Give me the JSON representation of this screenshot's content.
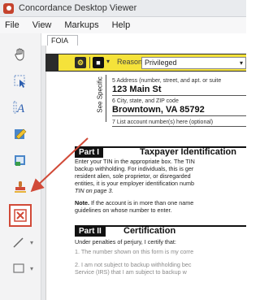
{
  "window": {
    "title": "Concordance Desktop Viewer"
  },
  "menu": [
    "File",
    "View",
    "Markups",
    "Help"
  ],
  "document_tab": "FOIA",
  "redaction_toolbar": {
    "reason_label": "Reason",
    "reason_value": "Privileged"
  },
  "tools": [
    {
      "name": "hand-icon"
    },
    {
      "name": "select-arrow-icon"
    },
    {
      "name": "text-tool-icon"
    },
    {
      "name": "highlight-marker-icon"
    },
    {
      "name": "note-tool-icon"
    },
    {
      "name": "stamp-icon"
    },
    {
      "name": "redact-box-icon",
      "selected": true
    },
    {
      "name": "line-tool-icon"
    },
    {
      "name": "rectangle-tool-icon"
    }
  ],
  "form": {
    "side_label": "See Specific",
    "fields": [
      {
        "label": "5 Address (number, street, and apt. or suite",
        "value": "123 Main St"
      },
      {
        "label": "6 City, state, and ZIP code",
        "value": "Browntown, VA 85792"
      },
      {
        "label": "7 List account number(s) here (optional)",
        "value": ""
      }
    ],
    "part1": {
      "badge": "Part I",
      "title": "Taxpayer Identification",
      "lines": [
        "Enter your TIN in the appropriate box. The TIN",
        "backup withholding. For individuals, this is ger",
        "resident alien, sole proprietor, or disregarded",
        "entities, it is your employer identification numb",
        "TIN on page 3."
      ],
      "note_bold": "Note.",
      "note_lines": [
        " If the account is in more than one name",
        "guidelines on whose number to enter."
      ]
    },
    "part2": {
      "badge": "Part II",
      "title": "Certification",
      "lines": [
        "Under penalties of perjury, I certify that:",
        "1.  The number shown on this form is my corre",
        "2.  I am not subject to backup withholding bec",
        "     Service (IRS) that I am subject to backup w"
      ]
    }
  },
  "colors": {
    "redaction_bar": "#f5e23a",
    "selection_outline": "#d14a38",
    "arrow": "#d14a38"
  }
}
